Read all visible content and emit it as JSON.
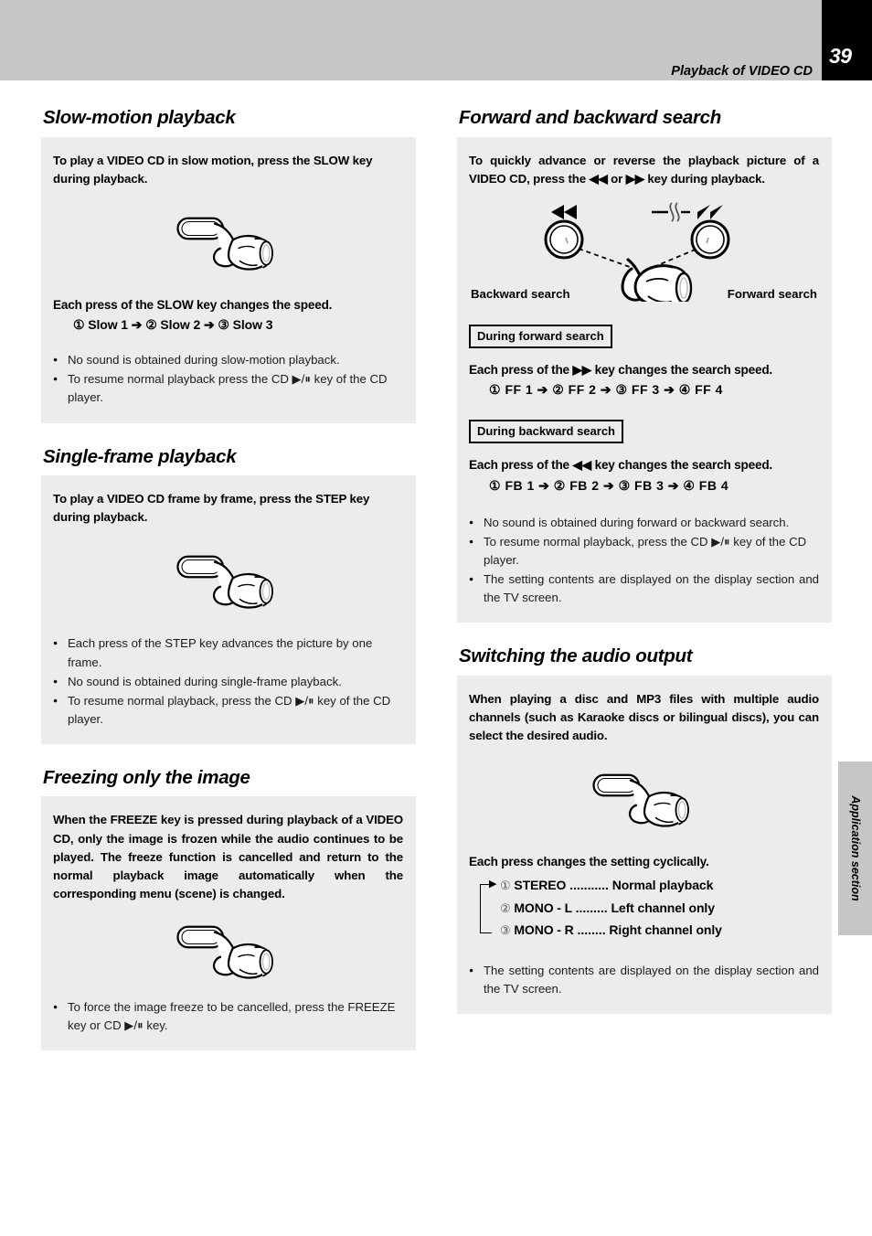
{
  "header": {
    "title": "Playback of VIDEO CD",
    "page_number": "39"
  },
  "side_tab": {
    "label": "Application section"
  },
  "left_column": {
    "slow_motion": {
      "title": "Slow-motion playback",
      "intro": "To play a VIDEO CD in slow motion, press the SLOW key during playback.",
      "illustration": "hand-pressing-key",
      "speed_heading": "Each press of the SLOW key changes the speed.",
      "speed_sequence": "① Slow 1 ➔ ② Slow 2 ➔ ③ Slow 3",
      "bullets": [
        "No sound is obtained during slow-motion playback.",
        "To resume normal playback press the CD ▶/⏸ key of the CD player."
      ]
    },
    "single_frame": {
      "title": "Single-frame playback",
      "intro": "To play a VIDEO CD frame by frame, press the STEP key during playback.",
      "illustration": "hand-pressing-key",
      "bullets": [
        "Each press of the STEP key advances the picture by one frame.",
        "No sound is obtained during single-frame playback.",
        "To resume normal playback, press the  CD ▶/⏸ key of the CD player."
      ]
    },
    "freezing": {
      "title": "Freezing only the image",
      "intro": "When the FREEZE key is pressed during playback of a VIDEO CD, only the image is frozen while the audio continues to be played. The freeze function is cancelled and return to the normal playback image automatically when the corresponding menu (scene) is changed.",
      "illustration": "hand-pressing-key",
      "bullets": [
        "To force the image freeze to be cancelled, press the FREEZE key or CD ▶/⏸ key."
      ]
    }
  },
  "right_column": {
    "search": {
      "title": "Forward and backward search",
      "intro": "To quickly advance or reverse the playback picture of a VIDEO CD, press the ◀◀ or ▶▶ key during playback.",
      "illustration": "hand-pointing-two-round-keys",
      "label_backward": "Backward search",
      "label_forward": "Forward search",
      "icon_backward": "◀◀",
      "icon_forward": "▶▶",
      "forward_box": "During forward search",
      "forward_heading": "Each press of the ▶▶ key changes the search speed.",
      "forward_sequence": "① FF  1 ➔ ② FF  2 ➔ ③ FF  3 ➔ ④ FF  4",
      "backward_box": "During backward search",
      "backward_heading": "Each press of the ◀◀ key changes the search speed.",
      "backward_sequence": "① FB  1 ➔ ② FB  2 ➔ ③ FB  3 ➔ ④ FB  4",
      "bullets": [
        "No sound is obtained during forward or backward search.",
        "To resume normal playback, press the CD ▶/⏸ key of the CD player.",
        "The setting contents are displayed on the display section and the TV screen."
      ]
    },
    "audio_output": {
      "title": "Switching the audio output",
      "intro": "When playing a disc and MP3 files with multiple audio channels (such as Karaoke discs or bilingual discs), you can select the desired audio.",
      "illustration": "hand-pressing-key",
      "cycle_heading": "Each press changes the setting cyclically.",
      "cycle_items": [
        {
          "num": "①",
          "name": "STEREO",
          "dots": "...........",
          "desc": "Normal playback"
        },
        {
          "num": "②",
          "name": "MONO - L",
          "dots": ".........",
          "desc": "Left channel only"
        },
        {
          "num": "③",
          "name": "MONO - R",
          "dots": "........",
          "desc": "Right channel only"
        }
      ],
      "bullets": [
        "The setting contents are displayed on the display section and the TV screen."
      ]
    }
  },
  "colors": {
    "header_band": "#c6c6c6",
    "panel_bg": "#ececec",
    "page_box": "#000000"
  }
}
